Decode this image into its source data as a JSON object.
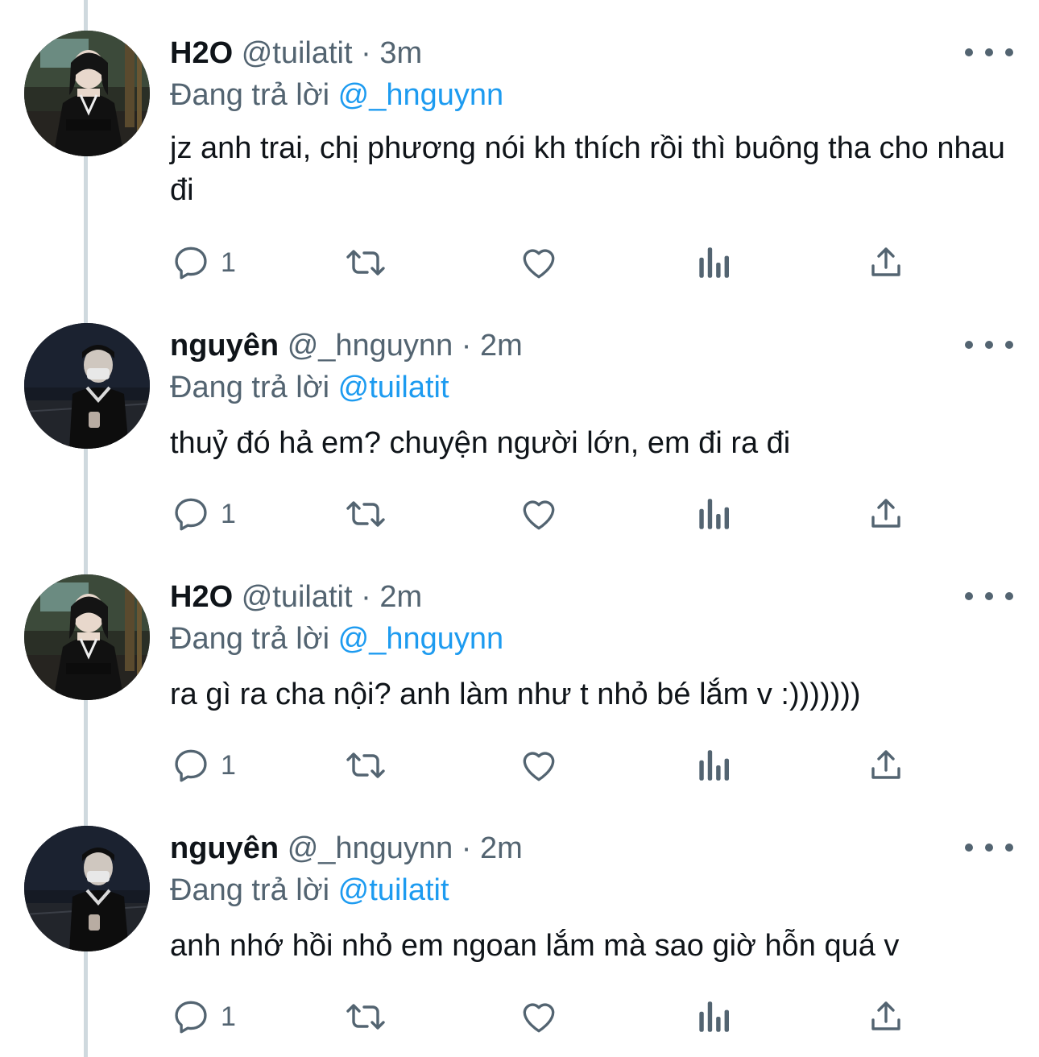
{
  "colors": {
    "text": "#0f1419",
    "secondary": "#536471",
    "accent": "#1d9bf0",
    "thread_line": "#cfd9de"
  },
  "reply_prefix": "Đang trả lời",
  "tweets": [
    {
      "name": "H2O",
      "handle": "@tuilatit",
      "separator": "·",
      "time": "3m",
      "replying_to": "@_hnguynn",
      "text": "jz anh trai, chị phương nói kh thích rồi thì buông tha cho nhau đi",
      "reply_count": "1",
      "avatar_icon": "avatar-girl-photo"
    },
    {
      "name": "nguyên",
      "handle": "@_hnguynn",
      "separator": "·",
      "time": "2m",
      "replying_to": "@tuilatit",
      "text": "thuỷ đó hả em? chuyện người lớn, em đi ra đi",
      "reply_count": "1",
      "avatar_icon": "avatar-boy-photo"
    },
    {
      "name": "H2O",
      "handle": "@tuilatit",
      "separator": "·",
      "time": "2m",
      "replying_to": "@_hnguynn",
      "text": "ra gì ra cha nội? anh làm như t nhỏ bé lắm v :)))))))",
      "reply_count": "1",
      "avatar_icon": "avatar-girl-photo"
    },
    {
      "name": "nguyên",
      "handle": "@_hnguynn",
      "separator": "·",
      "time": "2m",
      "replying_to": "@tuilatit",
      "text": "anh nhớ hồi nhỏ em ngoan lắm mà sao giờ hỗn quá v",
      "reply_count": "1",
      "avatar_icon": "avatar-boy-photo"
    }
  ]
}
